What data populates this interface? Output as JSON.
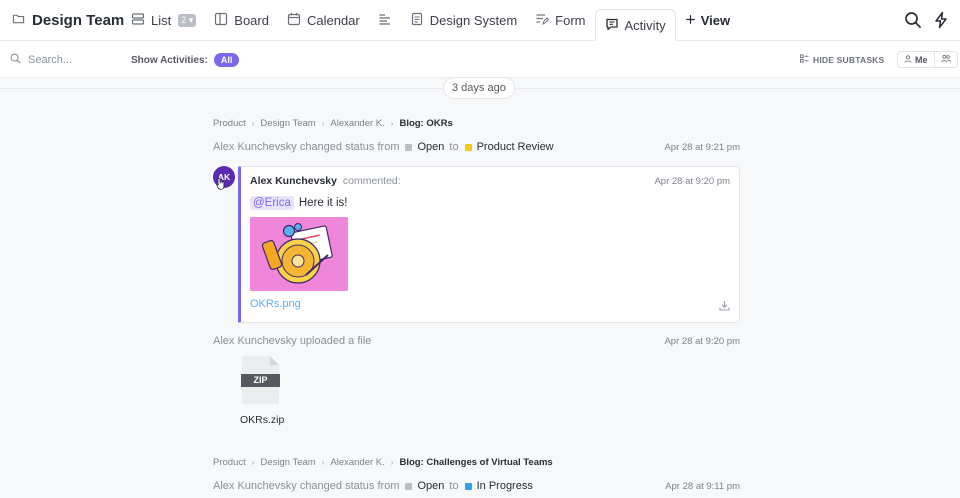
{
  "header": {
    "title": "Design Team",
    "views": [
      {
        "label": "List",
        "badge": "2"
      },
      {
        "label": "Board"
      },
      {
        "label": "Calendar"
      },
      {
        "label": ""
      },
      {
        "label": "Design System"
      },
      {
        "label": "Form"
      },
      {
        "label": "Activity"
      }
    ],
    "add_view": "View"
  },
  "toolbar": {
    "search_placeholder": "Search...",
    "show_activities_label": "Show Activities:",
    "show_activities_value": "All",
    "hide_subtasks": "HIDE SUBTASKS",
    "me_label": "Me"
  },
  "feed": {
    "date_label": "3 days ago",
    "items": [
      {
        "breadcrumb": [
          "Product",
          "Design Team",
          "Alexander K.",
          "Blog: OKRs"
        ],
        "actor": "Alex Kunchevsky changed status from",
        "from_status": "Open",
        "to_word": "to",
        "to_status": "Product Review",
        "time": "Apr 28 at 9:21 pm"
      },
      {
        "avatar_initials": "AK",
        "author": "Alex Kunchevsky",
        "verb": "commented:",
        "time": "Apr 28 at 9:20 pm",
        "mention": "@Erica",
        "text": "Here it is!",
        "file_name": "OKRs.png"
      },
      {
        "actor": "Alex Kunchevsky uploaded a file",
        "time": "Apr 28 at 9:20 pm",
        "file_type": "ZIP",
        "file_name": "OKRs.zip"
      },
      {
        "breadcrumb": [
          "Product",
          "Design Team",
          "Alexander K.",
          "Blog: Challenges of Virtual Teams"
        ],
        "actor": "Alex Kunchevsky changed status from",
        "from_status": "Open",
        "to_word": "to",
        "to_status": "In Progress",
        "time": "Apr 28 at 9:11 pm"
      }
    ]
  },
  "colors": {
    "accent": "#7b68ee",
    "status_open": "#b9bec7",
    "status_product_review": "#f8c51c",
    "status_in_progress": "#2aa2f0",
    "avatar_bg": "#5a2bb0",
    "link": "#5aaef2"
  },
  "icons": [
    "folder-icon",
    "list-icon",
    "board-icon",
    "calendar-icon",
    "gantt-icon",
    "doc-icon",
    "form-icon",
    "activity-icon",
    "plus-icon",
    "search-icon",
    "lightning-icon",
    "subtasks-icon",
    "user-icon",
    "users-icon",
    "download-icon",
    "zip-file-icon"
  ]
}
